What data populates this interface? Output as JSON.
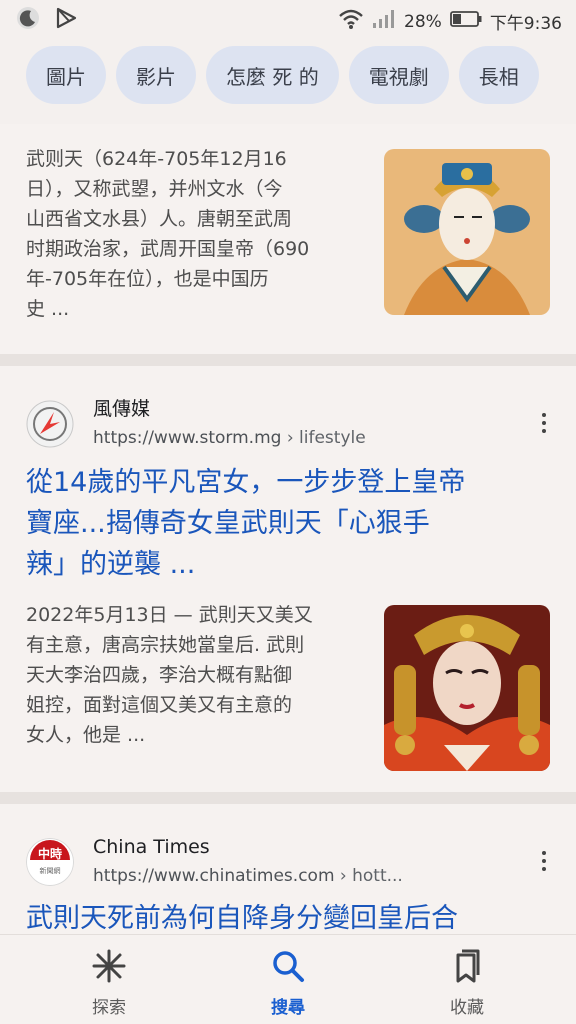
{
  "status_bar": {
    "battery": "28%",
    "time": "下午9:36"
  },
  "chips": [
    "圖片",
    "影片",
    "怎麼 死 的",
    "電視劇",
    "長相"
  ],
  "results": [
    {
      "snippet": [
        "武则天（624年-705年12月16",
        "日），又称武曌，并州文水（今",
        "山西省文水县）人。唐朝至武周",
        "时期政治家，武周开国皇帝（690",
        "年-705年在位），也是中国历",
        "史 ..."
      ]
    },
    {
      "site_name": "風傳媒",
      "url": "https://www.storm.mg",
      "crumb": " › lifestyle",
      "title": [
        "從14歲的平凡宮女，一步步登上皇帝",
        "寶座...揭傳奇女皇武則天「心狠手",
        "辣」的逆襲 ..."
      ],
      "snippet": [
        "2022年5月13日 — 武則天又美又",
        "有主意，唐高宗扶她當皇后. 武則",
        "天大李治四歲，李治大概有點御",
        "姐控，面對這個又美又有主意的",
        "女人，他是 ..."
      ]
    },
    {
      "site_name": "China Times",
      "url": "https://www.chinatimes.com",
      "crumb": " › hott...",
      "favicon_text": [
        "中時",
        "新聞網"
      ],
      "title": [
        "武則天死前為何自降身分變回皇后合"
      ]
    }
  ],
  "bottom_nav": [
    {
      "label": "探索",
      "icon": "asterisk-icon",
      "active": false
    },
    {
      "label": "搜尋",
      "icon": "search-icon",
      "active": true
    },
    {
      "label": "收藏",
      "icon": "bookmarks-icon",
      "active": false
    }
  ],
  "colors": {
    "link": "#1a56bb",
    "active_nav": "#1a5fd0",
    "chip_bg": "#dde3f1"
  }
}
